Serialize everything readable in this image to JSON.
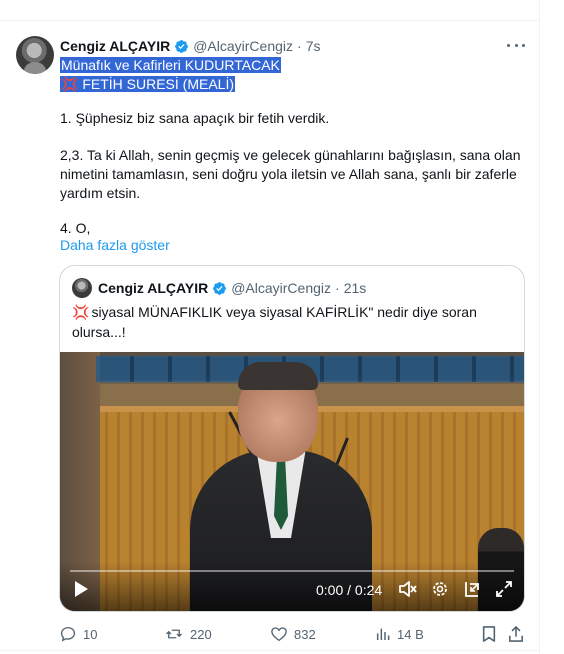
{
  "post": {
    "author_name": "Cengiz ALÇAYIR",
    "handle": "@AlcayirCengiz",
    "separator": "·",
    "time": "7s",
    "lines": {
      "l1": "Münafık ve Kafirleri KUDURTACAK",
      "l2_emoji": "💢",
      "l2": "FETİH SURESİ (MEALİ)",
      "l3": "1. Şüphesiz biz sana apaçık bir fetih verdik.",
      "l4": "2,3. Ta ki Allah, senin geçmiş ve gelecek günahlarını bağışlasın, sana olan",
      "l5": "nimetini tamamlasın, seni doğru yola iletsin ve Allah sana, şanlı bir zaferle",
      "l6": "yardım etsin.",
      "l7": "4. O,"
    },
    "show_more": "Daha fazla göster"
  },
  "quote": {
    "author_name": "Cengiz ALÇAYIR",
    "handle": "@AlcayirCengiz",
    "separator": "·",
    "time": "21s",
    "emoji": "💢",
    "text_line1": "siyasal MÜNAFIKLIK veya siyasal KAFİRLİK\" nedir diye soran",
    "text_line2": "olursa...!"
  },
  "video": {
    "time_display": "0:00 / 0:24",
    "progress": 0
  },
  "actions": {
    "replies": "10",
    "reposts": "220",
    "likes": "832",
    "views": "14 B"
  },
  "colors": {
    "accent": "#1d9bf0",
    "selection": "#3367d6",
    "muted_text": "#536471",
    "border": "#cfd9de"
  }
}
